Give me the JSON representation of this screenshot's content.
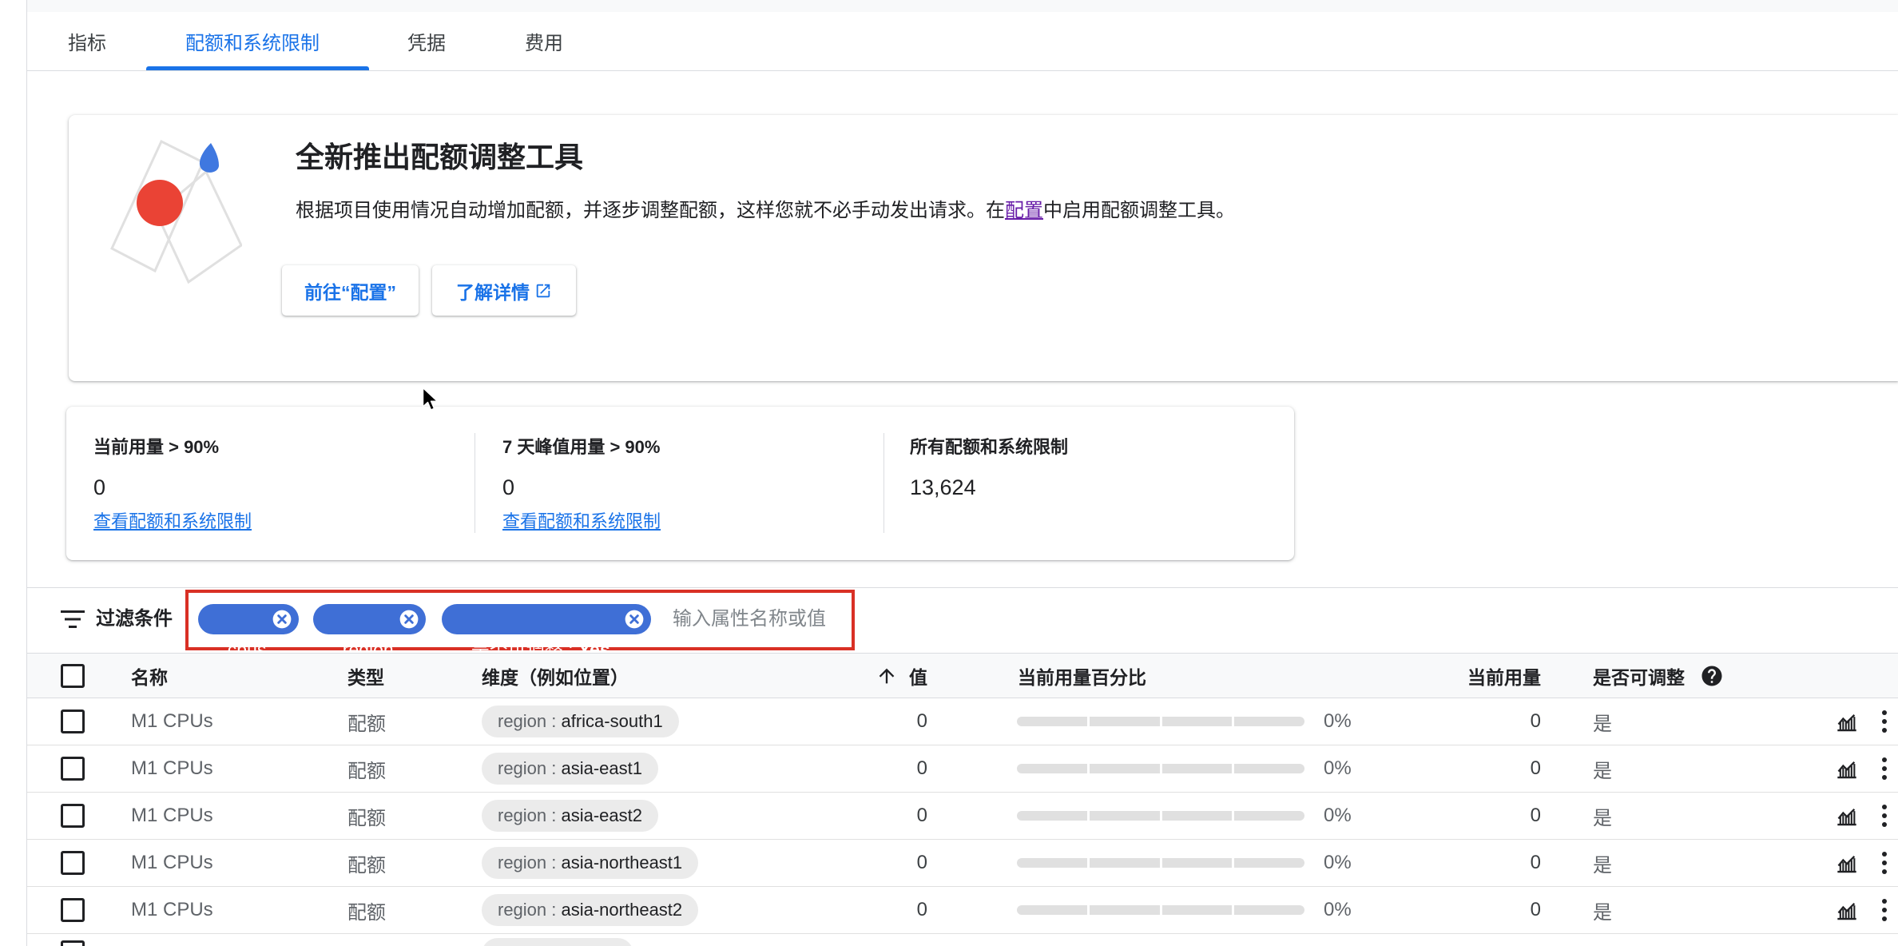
{
  "tabs": [
    {
      "label": "指标",
      "active": false
    },
    {
      "label": "配额和系统限制",
      "active": true
    },
    {
      "label": "凭据",
      "active": false
    },
    {
      "label": "费用",
      "active": false
    }
  ],
  "banner": {
    "title": "全新推出配额调整工具",
    "description_before": "根据项目使用情况自动增加配额，并逐步调整配额，这样您就不必手动发出请求。在",
    "description_link": "配置",
    "description_after": "中启用配额调整工具。",
    "primary_button": "前往“配置”",
    "secondary_button": "了解详情"
  },
  "stats": [
    {
      "label": "当前用量 > 90%",
      "value": "0",
      "link": "查看配额和系统限制"
    },
    {
      "label": "7 天峰值用量 > 90%",
      "value": "0",
      "link": "查看配额和系统限制"
    },
    {
      "label": "所有配额和系统限制",
      "value": "13,624"
    }
  ],
  "filter": {
    "label": "过滤条件",
    "chips": [
      {
        "key": "cpus",
        "value": ""
      },
      {
        "key": "region",
        "value": ""
      },
      {
        "key": "是否可调整 : ",
        "value": "Yes"
      }
    ],
    "placeholder": "输入属性名称或值"
  },
  "table": {
    "headers": {
      "name": "名称",
      "type": "类型",
      "dimension": "维度（例如位置）",
      "value": "值",
      "usage_percent": "当前用量百分比",
      "usage": "当前用量",
      "adjustable": "是否可调整"
    },
    "sorted_column": "value",
    "sort_direction": "ascending",
    "rows": [
      {
        "name": "M1 CPUs",
        "type": "配额",
        "dimension": {
          "key": "region : ",
          "value": "africa-south1"
        },
        "value": "0",
        "usage_fraction": 0,
        "usage_percent_label": "0%",
        "usage": "0",
        "adjustable": "是"
      },
      {
        "name": "M1 CPUs",
        "type": "配额",
        "dimension": {
          "key": "region : ",
          "value": "asia-east1"
        },
        "value": "0",
        "usage_fraction": 0,
        "usage_percent_label": "0%",
        "usage": "0",
        "adjustable": "是"
      },
      {
        "name": "M1 CPUs",
        "type": "配额",
        "dimension": {
          "key": "region : ",
          "value": "asia-east2"
        },
        "value": "0",
        "usage_fraction": 0,
        "usage_percent_label": "0%",
        "usage": "0",
        "adjustable": "是"
      },
      {
        "name": "M1 CPUs",
        "type": "配额",
        "dimension": {
          "key": "region : ",
          "value": "asia-northeast1"
        },
        "value": "0",
        "usage_fraction": 0,
        "usage_percent_label": "0%",
        "usage": "0",
        "adjustable": "是"
      },
      {
        "name": "M1 CPUs",
        "type": "配额",
        "dimension": {
          "key": "region : ",
          "value": "asia-northeast2"
        },
        "value": "0",
        "usage_fraction": 0,
        "usage_percent_label": "0%",
        "usage": "0",
        "adjustable": "是"
      }
    ]
  },
  "icons": {
    "filter": "filter-list-icon",
    "chip_remove": "cancel-circle-icon",
    "external_link": "open-in-new-icon",
    "sort": "arrow-upward-icon",
    "help": "help-circle-icon",
    "row_chart": "monitoring-chart-icon",
    "row_menu": "more-vert-icon",
    "pointer": "mouse-cursor-icon"
  },
  "colors": {
    "accent": "#1a73e8",
    "filter_chip": "#3f6fd6",
    "highlight_box": "#d93025",
    "visited_link": "#681da8",
    "illustration_red": "#ea4335",
    "illustration_blue": "#3f78e0"
  }
}
